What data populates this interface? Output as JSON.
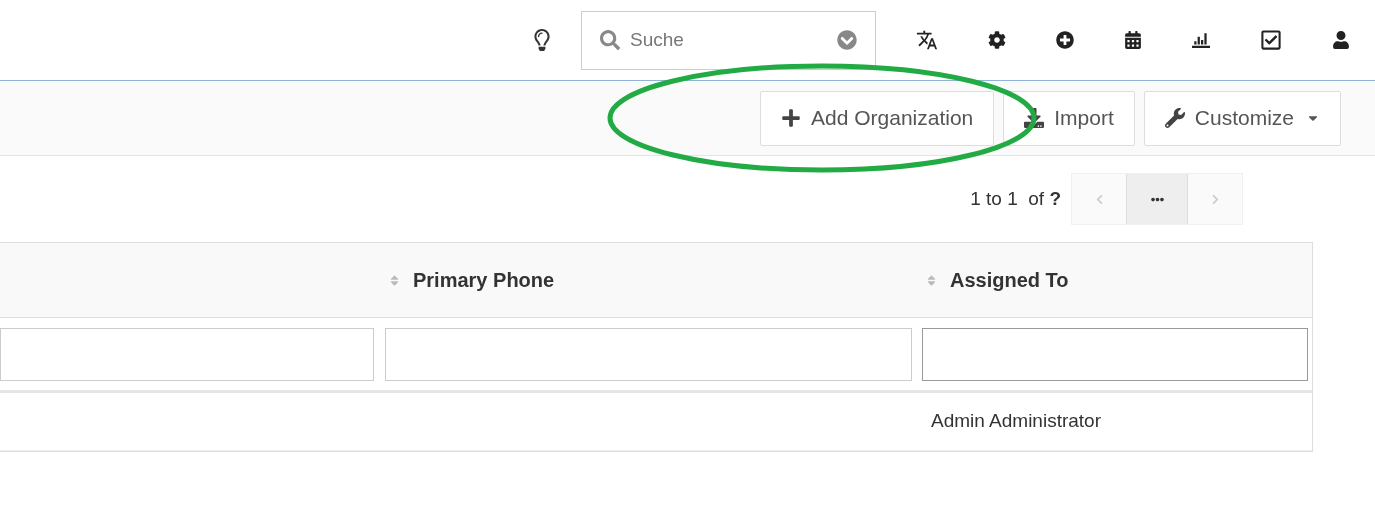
{
  "search": {
    "placeholder": "Suche"
  },
  "toolbar": {
    "buttons": [
      {
        "kind": "add",
        "label": "Add Organization"
      },
      {
        "kind": "import",
        "label": "Import"
      },
      {
        "kind": "customize",
        "label": "Customize"
      }
    ]
  },
  "pagination": {
    "range": "1 to 1  of **?**"
  },
  "table": {
    "columns": [
      {
        "kind": "blank"
      },
      {
        "kind": "sortable",
        "label": "Primary Phone"
      },
      {
        "kind": "sortable",
        "label": "Assigned To"
      }
    ],
    "filters": [
      {
        "focused": false
      },
      {
        "focused": false
      },
      {
        "focused": true
      }
    ],
    "rows": [
      {
        "cells": [
          null,
          null,
          "Admin Administrator"
        ]
      }
    ]
  }
}
